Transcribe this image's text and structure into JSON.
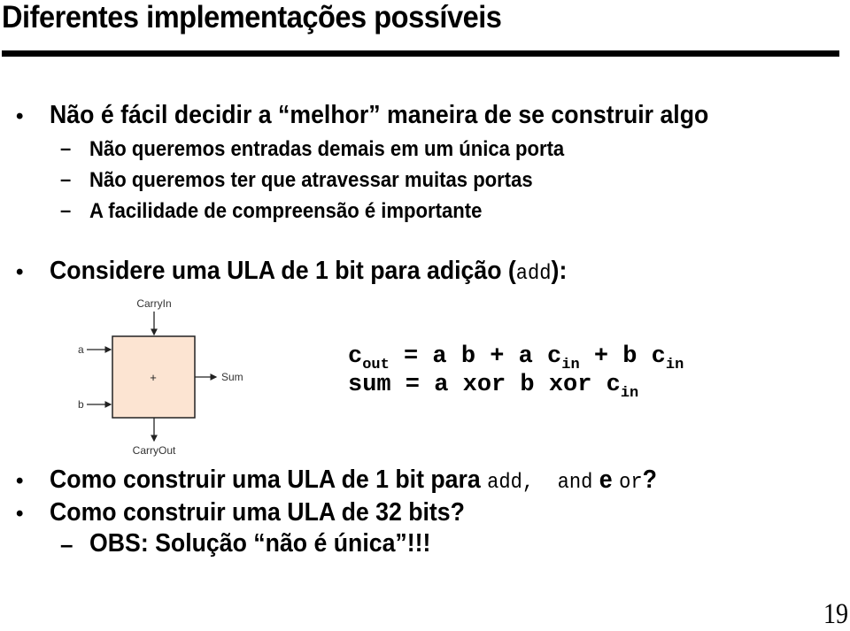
{
  "slide": {
    "title": "Diferentes implementações possíveis",
    "page_number": "19"
  },
  "bullets": [
    {
      "text": "Não é fácil decidir a “melhor” maneira de se construir algo",
      "sub": [
        "Não queremos entradas demais em um única porta",
        "Não queremos ter que atravessar muitas portas",
        "A facilidade de compreensão é importante"
      ]
    },
    {
      "text_before": "Considere uma ULA de 1 bit para adição (",
      "code": "add",
      "text_after": "):"
    },
    {
      "text_before": "Como construir uma ULA de 1 bit para ",
      "code1": "add,  and",
      "text_mid": " e ",
      "code2": "or",
      "text_after": "?"
    },
    {
      "text": "Como construir uma ULA de 32 bits?",
      "sub": [
        "OBS: Solução “não é única”!!!"
      ]
    }
  ],
  "diagram": {
    "carry_in_label": "CarryIn",
    "carry_out_label": "CarryOut",
    "input_a_label": "a",
    "input_b_label": "b",
    "output_label": "Sum",
    "operator_symbol": "+",
    "box_fill": "#fce4d2"
  },
  "formulas": {
    "cout": {
      "lhs": "c",
      "lhs_sub": "out",
      "rhs_parts": [
        "= a b + a c",
        "in",
        " + b c",
        "in"
      ]
    },
    "sum": {
      "lhs": "sum",
      "rhs": " = a xor b xor c",
      "rhs_sub": "in"
    }
  },
  "symbols": {
    "bullet": "•",
    "dash": "–"
  }
}
